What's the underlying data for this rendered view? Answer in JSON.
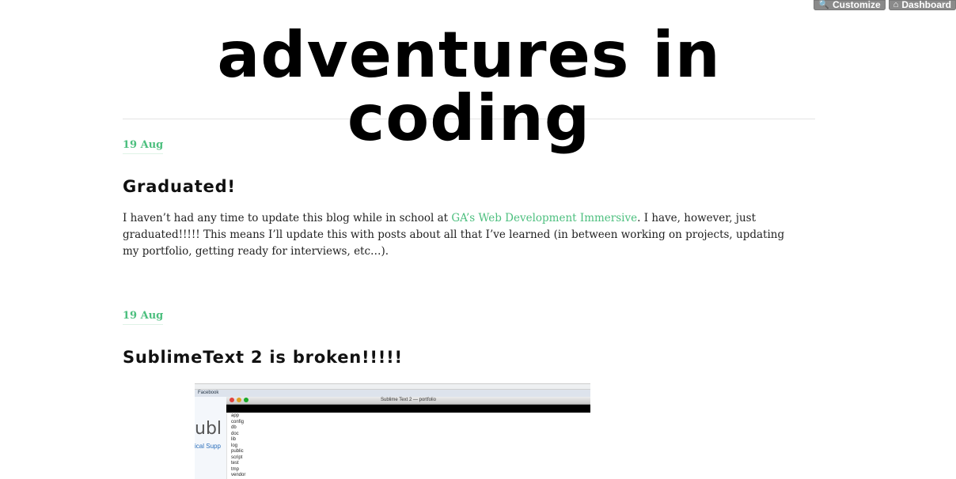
{
  "topbar": {
    "customize_label": "Customize",
    "dashboard_label": "Dashboard",
    "customize_icon": "search-icon",
    "dashboard_icon": "home-icon"
  },
  "blog": {
    "title": "adventures in coding"
  },
  "posts": [
    {
      "date": "19 Aug",
      "title": "Graduated!",
      "body_before": "I haven’t had any time to update this blog while in school at ",
      "link_text": "GA’s Web Development Immersive",
      "body_after": ".  I have, however, just graduated!!!!!  This means I’ll update this with posts about all that I’ve learned (in between working on projects, updating my portfolio, getting ready for interviews, etc…)."
    },
    {
      "date": "19 Aug",
      "title": "SublimeText 2 is broken!!!!!",
      "image": {
        "bookmark_first": "Facebook",
        "window_title": "Sublime Text 2 — portfolio",
        "page_fragment": "ubl",
        "page_support": "ical Supp",
        "folders": [
          "app",
          "config",
          "db",
          "doc",
          "lib",
          "log",
          "public",
          "script",
          "test",
          "tmp",
          "vendor"
        ]
      }
    }
  ],
  "colors": {
    "accent_green": "#4cbf7e",
    "topbar_gray": "#8a8a8a"
  }
}
